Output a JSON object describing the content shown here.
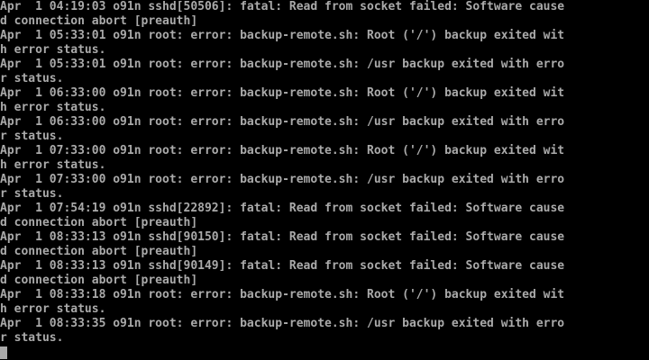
{
  "console": {
    "lines": [
      "Apr  1 04:19:03 o91n sshd[50506]: fatal: Read from socket failed: Software cause",
      "d connection abort [preauth]",
      "Apr  1 05:33:01 o91n root: error: backup-remote.sh: Root ('/') backup exited wit",
      "h error status.",
      "Apr  1 05:33:01 o91n root: error: backup-remote.sh: /usr backup exited with erro",
      "r status.",
      "Apr  1 06:33:00 o91n root: error: backup-remote.sh: Root ('/') backup exited wit",
      "h error status.",
      "Apr  1 06:33:00 o91n root: error: backup-remote.sh: /usr backup exited with erro",
      "r status.",
      "Apr  1 07:33:00 o91n root: error: backup-remote.sh: Root ('/') backup exited wit",
      "h error status.",
      "Apr  1 07:33:00 o91n root: error: backup-remote.sh: /usr backup exited with erro",
      "r status.",
      "Apr  1 07:54:19 o91n sshd[22892]: fatal: Read from socket failed: Software cause",
      "d connection abort [preauth]",
      "Apr  1 08:33:13 o91n sshd[90150]: fatal: Read from socket failed: Software cause",
      "d connection abort [preauth]",
      "Apr  1 08:33:13 o91n sshd[90149]: fatal: Read from socket failed: Software cause",
      "d connection abort [preauth]",
      "Apr  1 08:33:18 o91n root: error: backup-remote.sh: Root ('/') backup exited wit",
      "h error status.",
      "Apr  1 08:33:35 o91n root: error: backup-remote.sh: /usr backup exited with erro",
      "r status."
    ],
    "colors": {
      "background": "#000000",
      "text": "#aaaaaa",
      "cursor": "#aaaaaa"
    }
  }
}
